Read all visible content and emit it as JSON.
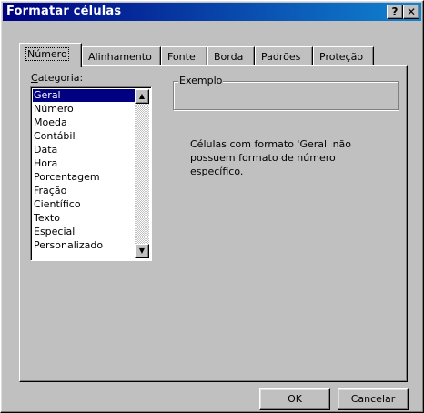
{
  "window": {
    "title": "Formatar células",
    "help": "?",
    "close": "✕"
  },
  "tabs": [
    "Número",
    "Alinhamento",
    "Fonte",
    "Borda",
    "Padrões",
    "Proteção"
  ],
  "category": {
    "label_first": "C",
    "label_rest": "ategoria:",
    "items": [
      "Geral",
      "Número",
      "Moeda",
      "Contábil",
      "Data",
      "Hora",
      "Porcentagem",
      "Fração",
      "Científico",
      "Texto",
      "Especial",
      "Personalizado"
    ],
    "selected": "Geral"
  },
  "sample": {
    "label": "Exemplo",
    "value": ""
  },
  "description": "Células com formato 'Geral' não possuem formato de número específico.",
  "buttons": {
    "ok": "OK",
    "cancel": "Cancelar"
  },
  "colors": {
    "titlebar": "#000080",
    "selection": "#000080",
    "face": "#c0c0c0"
  },
  "icons": {
    "scroll_up": "triangle-up-icon",
    "scroll_down": "triangle-down-icon"
  }
}
